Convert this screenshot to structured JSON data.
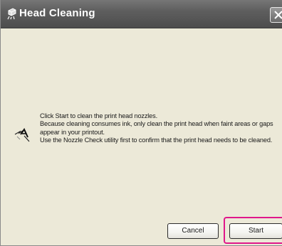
{
  "window": {
    "title": "Head Cleaning"
  },
  "message": {
    "lines": [
      "Click Start to clean the print head nozzles.",
      "Because cleaning consumes ink, only clean the print head when faint areas or gaps appear in your printout.",
      "Use the Nozzle Check utility first to confirm that the print head needs to be cleaned."
    ]
  },
  "buttons": {
    "cancel_label": "Cancel",
    "start_label": "Start"
  },
  "colors": {
    "titlebar": "#5e5e5e",
    "window_bg": "#ece9d8",
    "highlight": "#e0178a"
  },
  "icons": {
    "title": "printer-cleaning-icon",
    "content": "nozzle-cleaning-icon",
    "close": "close-icon"
  }
}
